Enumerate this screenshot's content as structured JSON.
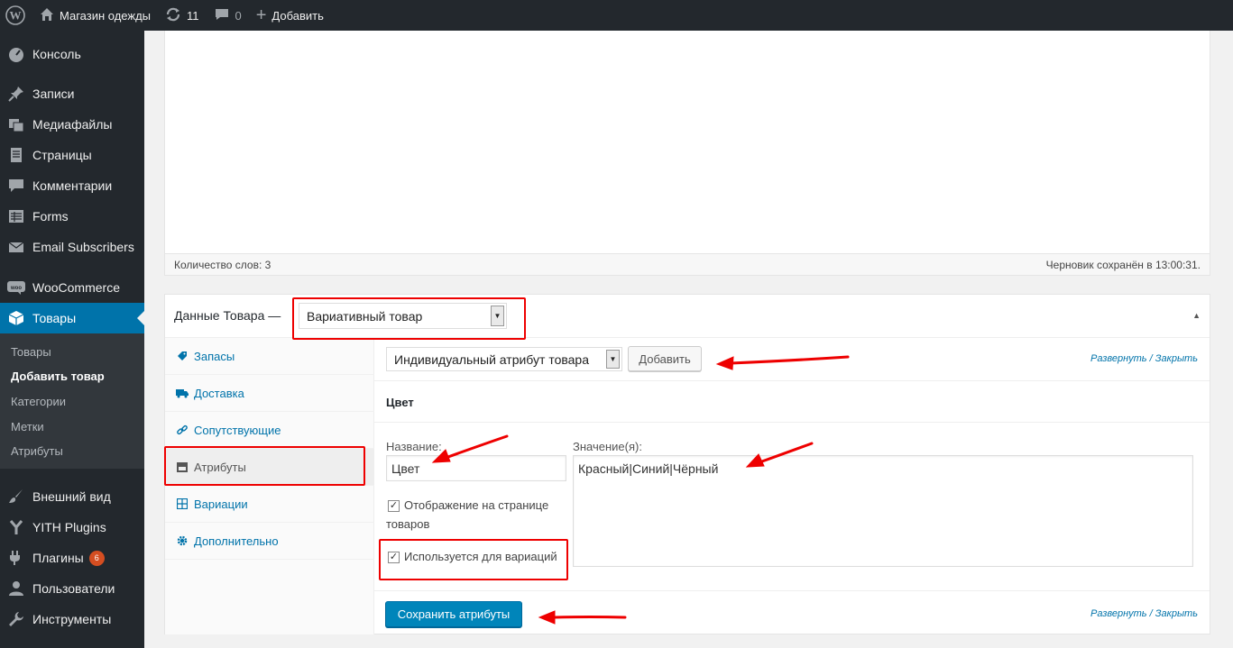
{
  "adminbar": {
    "site_name": "Магазин одежды",
    "updates_count": "11",
    "comments_count": "0",
    "add_new": "Добавить"
  },
  "sidebar": {
    "items": [
      {
        "label": "Консоль",
        "icon": "dashboard-icon"
      },
      {
        "label": "Записи",
        "icon": "pin-icon"
      },
      {
        "label": "Медиафайлы",
        "icon": "media-icon"
      },
      {
        "label": "Страницы",
        "icon": "page-icon"
      },
      {
        "label": "Комментарии",
        "icon": "comment-icon"
      },
      {
        "label": "Forms",
        "icon": "forms-icon"
      },
      {
        "label": "Email Subscribers",
        "icon": "email-icon"
      },
      {
        "label": "WooCommerce",
        "icon": "woocommerce-icon"
      },
      {
        "label": "Товары",
        "icon": "product-box-icon"
      },
      {
        "label": "Внешний вид",
        "icon": "brush-icon"
      },
      {
        "label": "YITH Plugins",
        "icon": "yith-icon"
      },
      {
        "label": "Плагины",
        "icon": "plugin-icon",
        "badge": "6"
      },
      {
        "label": "Пользователи",
        "icon": "user-icon"
      },
      {
        "label": "Инструменты",
        "icon": "wrench-icon"
      }
    ],
    "submenu": [
      {
        "label": "Товары"
      },
      {
        "label": "Добавить товар"
      },
      {
        "label": "Категории"
      },
      {
        "label": "Метки"
      },
      {
        "label": "Атрибуты"
      }
    ]
  },
  "editor": {
    "word_count": "Количество слов: 3",
    "draft_saved": "Черновик сохранён в 13:00:31."
  },
  "product_data": {
    "title": "Данные Товара —",
    "product_type": "Вариативный товар",
    "tabs": [
      {
        "label": "Запасы",
        "icon": "inventory-icon"
      },
      {
        "label": "Доставка",
        "icon": "truck-icon"
      },
      {
        "label": "Сопутствующие",
        "icon": "link-icon"
      },
      {
        "label": "Атрибуты",
        "icon": "attributes-icon"
      },
      {
        "label": "Вариации",
        "icon": "grid-icon"
      },
      {
        "label": "Дополнительно",
        "icon": "gear-icon"
      }
    ],
    "attribute_select": "Индивидуальный атрибут товара",
    "add_button": "Добавить",
    "expand_collapse": "Развернуть / Закрыть",
    "attribute_name_heading": "Цвет",
    "name_label": "Название:",
    "name_value": "Цвет",
    "values_label": "Значение(я):",
    "values_value": "Красный|Синий|Чёрный",
    "visible_label_line1": "Отображение на странице",
    "visible_label_line2": "товаров",
    "variation_label": "Используется для вариаций",
    "save_button": "Сохранить атрибуты"
  },
  "colors": {
    "accent": "#0073aa",
    "admin_dark": "#23282d",
    "annotation_red": "#e00000"
  }
}
